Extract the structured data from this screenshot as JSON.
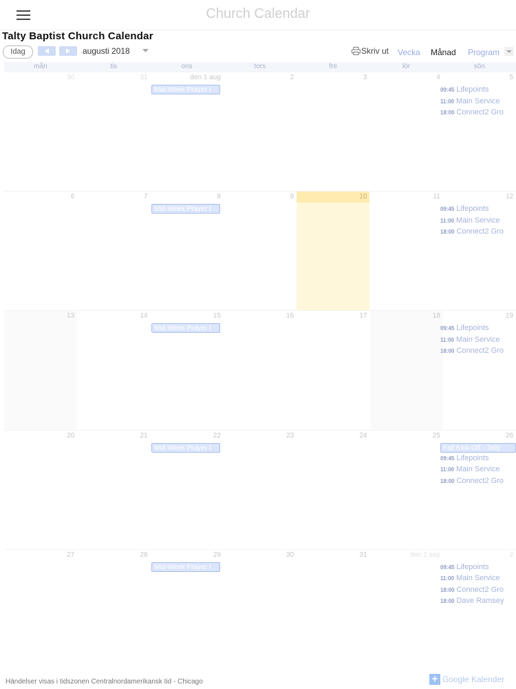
{
  "app": {
    "title": "Church Calendar"
  },
  "calendar": {
    "title": "Talty Baptist Church Calendar"
  },
  "toolbar": {
    "today_label": "Idag",
    "month_label": "augusti 2018",
    "print_label": "Skriv ut",
    "views": {
      "week": "Vecka",
      "month": "Månad",
      "agenda": "Program"
    },
    "active_view": "Månad"
  },
  "weekdays": [
    "mån",
    "tis",
    "ons",
    "tors",
    "fre",
    "lör",
    "sön"
  ],
  "weeks": [
    {
      "days": [
        {
          "label": "30",
          "dim": true,
          "shaded": false,
          "today": false
        },
        {
          "label": "31",
          "dim": true,
          "shaded": false,
          "today": false
        },
        {
          "label": "den 1 aug",
          "dim": false,
          "shaded": false,
          "today": false
        },
        {
          "label": "2",
          "dim": false,
          "shaded": false,
          "today": false
        },
        {
          "label": "3",
          "dim": false,
          "shaded": false,
          "today": false
        },
        {
          "label": "4",
          "dim": false,
          "shaded": false,
          "today": false
        },
        {
          "label": "5",
          "dim": false,
          "shaded": false,
          "today": false
        }
      ],
      "allday": [
        {
          "label": "Mid-Week Prayer I",
          "day": 2
        }
      ],
      "events": [
        {
          "time": "09:45",
          "title": "Lifepoints"
        },
        {
          "time": "11:00",
          "title": "Main Service"
        },
        {
          "time": "18:00",
          "title": "Connect2 Gro"
        }
      ]
    },
    {
      "days": [
        {
          "label": "6",
          "dim": false,
          "shaded": false,
          "today": false
        },
        {
          "label": "7",
          "dim": false,
          "shaded": false,
          "today": false
        },
        {
          "label": "8",
          "dim": false,
          "shaded": false,
          "today": false
        },
        {
          "label": "9",
          "dim": false,
          "shaded": false,
          "today": false
        },
        {
          "label": "10",
          "dim": false,
          "shaded": false,
          "today": true
        },
        {
          "label": "11",
          "dim": false,
          "shaded": false,
          "today": false
        },
        {
          "label": "12",
          "dim": false,
          "shaded": false,
          "today": false
        }
      ],
      "allday": [
        {
          "label": "Mid-Week Prayer I",
          "day": 2
        }
      ],
      "events": [
        {
          "time": "09:45",
          "title": "Lifepoints"
        },
        {
          "time": "11:00",
          "title": "Main Service"
        },
        {
          "time": "18:00",
          "title": "Connect2 Gro"
        }
      ]
    },
    {
      "days": [
        {
          "label": "13",
          "dim": false,
          "shaded": true,
          "today": false
        },
        {
          "label": "14",
          "dim": false,
          "shaded": false,
          "today": false
        },
        {
          "label": "15",
          "dim": false,
          "shaded": false,
          "today": false
        },
        {
          "label": "16",
          "dim": false,
          "shaded": false,
          "today": false
        },
        {
          "label": "17",
          "dim": false,
          "shaded": false,
          "today": false
        },
        {
          "label": "18",
          "dim": false,
          "shaded": true,
          "today": false
        },
        {
          "label": "19",
          "dim": false,
          "shaded": false,
          "today": false
        }
      ],
      "allday": [
        {
          "label": "Mid-Week Prayer I",
          "day": 2
        }
      ],
      "events": [
        {
          "time": "09:45",
          "title": "Lifepoints"
        },
        {
          "time": "11:00",
          "title": "Main Service"
        },
        {
          "time": "18:00",
          "title": "Connect2 Gro"
        }
      ]
    },
    {
      "days": [
        {
          "label": "20",
          "dim": false,
          "shaded": false,
          "today": false
        },
        {
          "label": "21",
          "dim": false,
          "shaded": false,
          "today": false
        },
        {
          "label": "22",
          "dim": false,
          "shaded": false,
          "today": false
        },
        {
          "label": "23",
          "dim": false,
          "shaded": false,
          "today": false
        },
        {
          "label": "24",
          "dim": false,
          "shaded": false,
          "today": false
        },
        {
          "label": "25",
          "dim": false,
          "shaded": false,
          "today": false
        },
        {
          "label": "26",
          "dim": false,
          "shaded": false,
          "today": false
        }
      ],
      "allday": [
        {
          "label": "Mid-Week Prayer I",
          "day": 2
        },
        {
          "label": "Fall Kick-Off - Talty",
          "day": 6
        }
      ],
      "events": [
        {
          "time": "09:45",
          "title": "Lifepoints"
        },
        {
          "time": "11:00",
          "title": "Main Service"
        },
        {
          "time": "18:00",
          "title": "Connect2 Gro"
        }
      ]
    },
    {
      "days": [
        {
          "label": "27",
          "dim": false,
          "shaded": false,
          "today": false
        },
        {
          "label": "28",
          "dim": false,
          "shaded": false,
          "today": false
        },
        {
          "label": "29",
          "dim": false,
          "shaded": false,
          "today": false
        },
        {
          "label": "30",
          "dim": false,
          "shaded": false,
          "today": false
        },
        {
          "label": "31",
          "dim": false,
          "shaded": false,
          "today": false
        },
        {
          "label": "den 1 sep",
          "dim": true,
          "shaded": false,
          "today": false
        },
        {
          "label": "2",
          "dim": true,
          "shaded": false,
          "today": false
        }
      ],
      "allday": [
        {
          "label": "Mid-Week Prayer I",
          "day": 2
        }
      ],
      "events": [
        {
          "time": "09:45",
          "title": "Lifepoints"
        },
        {
          "time": "11:00",
          "title": "Main Service"
        },
        {
          "time": "18:00",
          "title": "Connect2 Gro"
        },
        {
          "time": "18:00",
          "title": "Dave Ramsey"
        }
      ]
    }
  ],
  "footer": {
    "timezone_note": "Händelser visas i tidszonen Centralnordamerikansk tid - Chicago",
    "google_calendar_label": "Google Kalender"
  },
  "colors": {
    "event_chip_bg": "#dbe5fb",
    "event_chip_border": "#a7bdf0",
    "event_text": "#a6b3dd",
    "today_bg": "#fff7d9",
    "view_link": "#99a9e8"
  }
}
